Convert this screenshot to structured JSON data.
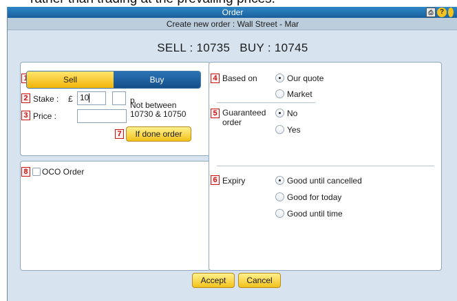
{
  "caption_text": "rather than trading at the prevailing prices.",
  "window": {
    "title": "Order",
    "icons": [
      "print-icon",
      "help-icon",
      "minimize-icon"
    ],
    "help_glyph": "?",
    "print_glyph": "⎙"
  },
  "subtitle": "Create new order : Wall Street - Mar",
  "quote": {
    "sell": "SELL : 10735",
    "buy": "BUY : 10745"
  },
  "markers": [
    "1",
    "2",
    "3",
    "4",
    "5",
    "6",
    "7",
    "8"
  ],
  "direction": {
    "sell_label": "Sell",
    "buy_label": "Buy",
    "selected": "Sell"
  },
  "stake": {
    "label": "Stake :",
    "currency": "£",
    "pounds_value": "10",
    "pence_value": "",
    "pence_unit": "p"
  },
  "price": {
    "label": "Price :",
    "value": "",
    "hint_line1": "Not between",
    "hint_line2": "10730 & 10750"
  },
  "if_done_button": "If done order",
  "oco": {
    "label": "OCO Order",
    "checked": false
  },
  "based_on": {
    "label": "Based on",
    "options": [
      "Our quote",
      "Market"
    ],
    "selected": "Our quote"
  },
  "guaranteed": {
    "label_line1": "Guaranteed",
    "label_line2": "order",
    "options": [
      "No",
      "Yes"
    ],
    "selected": "No"
  },
  "expiry": {
    "label": "Expiry",
    "options": [
      "Good until cancelled",
      "Good for today",
      "Good until time"
    ],
    "selected": "Good until cancelled"
  },
  "footer": {
    "accept": "Accept",
    "cancel": "Cancel"
  },
  "colors": {
    "accent_blue": "#1a5f9d",
    "button_yellow": "#f3c21b",
    "marker_red": "#cc1111",
    "dialog_bg": "#d7e4ef"
  }
}
